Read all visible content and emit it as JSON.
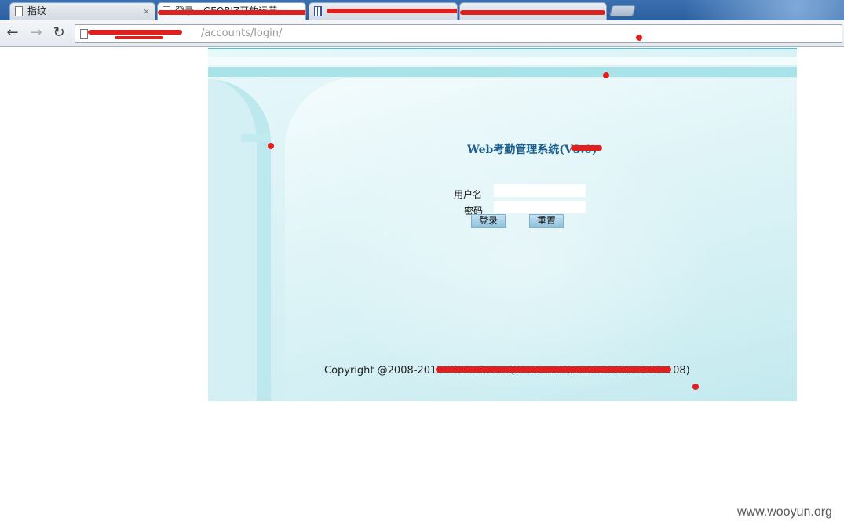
{
  "browser": {
    "tabs": [
      {
        "title": "指纹",
        "close_label": "×"
      },
      {
        "title": "登录 - GEOBIZ开放运营"
      },
      {
        "title": ""
      },
      {
        "title": ""
      }
    ],
    "nav": {
      "back_glyph": "←",
      "forward_glyph": "→",
      "reload_glyph": "↻"
    },
    "address": {
      "url": "/accounts/login/"
    }
  },
  "page": {
    "system_title": "Web考勤管理系统(V3.0)",
    "form": {
      "username_label": "用户名",
      "password_label": "密码",
      "username_value": "",
      "password_value": "",
      "login_button": "登录",
      "reset_button": "重置"
    },
    "copyright": "Copyright @2008-2018 GEOBIZ Inc. (Version: 3.0.7R1 Build: 20180108)"
  },
  "watermark": "www.wooyun.org",
  "colors": {
    "panel_background": "#d7f1f5",
    "title_color": "#1b5d8c",
    "redaction": "#e0201e",
    "tab_strip": "#2c5f9f"
  }
}
